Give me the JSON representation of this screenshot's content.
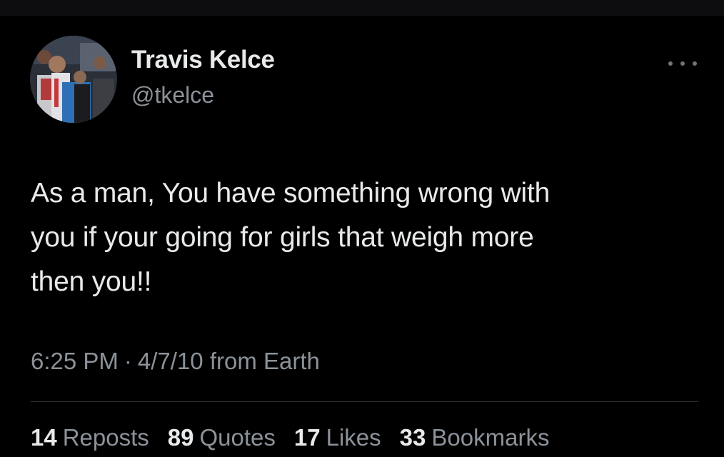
{
  "tweet": {
    "author": {
      "display_name": "Travis Kelce",
      "handle": "@tkelce"
    },
    "text": "As a man, You have something wrong with\nyou if your going for girls that weigh more\nthen you!!",
    "time": "6:25 PM",
    "separator": "·",
    "date_source": "4/7/10 from Earth"
  },
  "stats": [
    {
      "count": "14",
      "label": "Reposts"
    },
    {
      "count": "89",
      "label": "Quotes"
    },
    {
      "count": "17",
      "label": "Likes"
    },
    {
      "count": "33",
      "label": "Bookmarks"
    }
  ],
  "icons": {
    "more": "more-horizontal-icon"
  },
  "colors": {
    "background": "#000000",
    "primary_text": "#e7e9ea",
    "secondary_text": "#8b9299",
    "divider": "#2f3336"
  }
}
